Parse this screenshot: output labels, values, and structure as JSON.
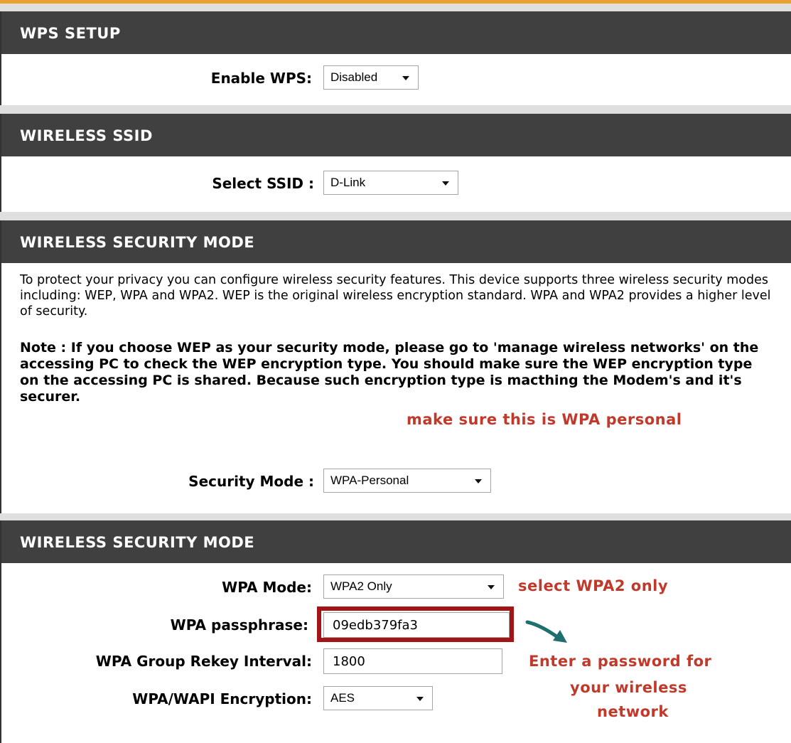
{
  "wps_setup": {
    "header": "WPS SETUP",
    "enable_wps_label": "Enable WPS:",
    "enable_wps_value": "Disabled"
  },
  "wireless_ssid": {
    "header": "WIRELESS SSID",
    "select_ssid_label": "Select SSID :",
    "select_ssid_value": "D-Link"
  },
  "security_mode_section": {
    "header": "WIRELESS SECURITY MODE",
    "description": "To protect your privacy you can configure wireless security features. This device supports three wireless security modes including: WEP, WPA and WPA2. WEP is the original wireless encryption standard. WPA and WPA2 provides a higher level of security.",
    "note": "Note : If you choose WEP as your security mode, please go to 'manage wireless networks' on the accessing PC to check the WEP encryption type. You should make sure the WEP encryption type on the accessing PC is shared. Because such encryption type is macthing the Modem's and it's securer.",
    "security_mode_label": "Security Mode :",
    "security_mode_value": "WPA-Personal",
    "annotation": "make sure this is WPA personal"
  },
  "wpa_section": {
    "header": "WIRELESS SECURITY MODE",
    "wpa_mode_label": "WPA Mode:",
    "wpa_mode_value": "WPA2 Only",
    "wpa_mode_annotation": "select WPA2 only",
    "passphrase_label": "WPA passphrase:",
    "passphrase_value": "09edb379fa3",
    "rekey_label": "WPA Group Rekey Interval:",
    "rekey_value": "1800",
    "encryption_label": "WPA/WAPI Encryption:",
    "encryption_value": "AES",
    "passphrase_annotation_line1": "Enter a password for",
    "passphrase_annotation_line2": "your wireless",
    "passphrase_annotation_line3": "network"
  },
  "colors": {
    "header_bg": "#404040",
    "accent_top": "#e8a035",
    "annotation_red": "#c0392b",
    "highlight_box": "#a51414",
    "arrow_teal": "#1f6f6f"
  },
  "icons": {
    "dropdown": "chevron-down-icon",
    "annotation_arrow": "arrow-icon"
  }
}
